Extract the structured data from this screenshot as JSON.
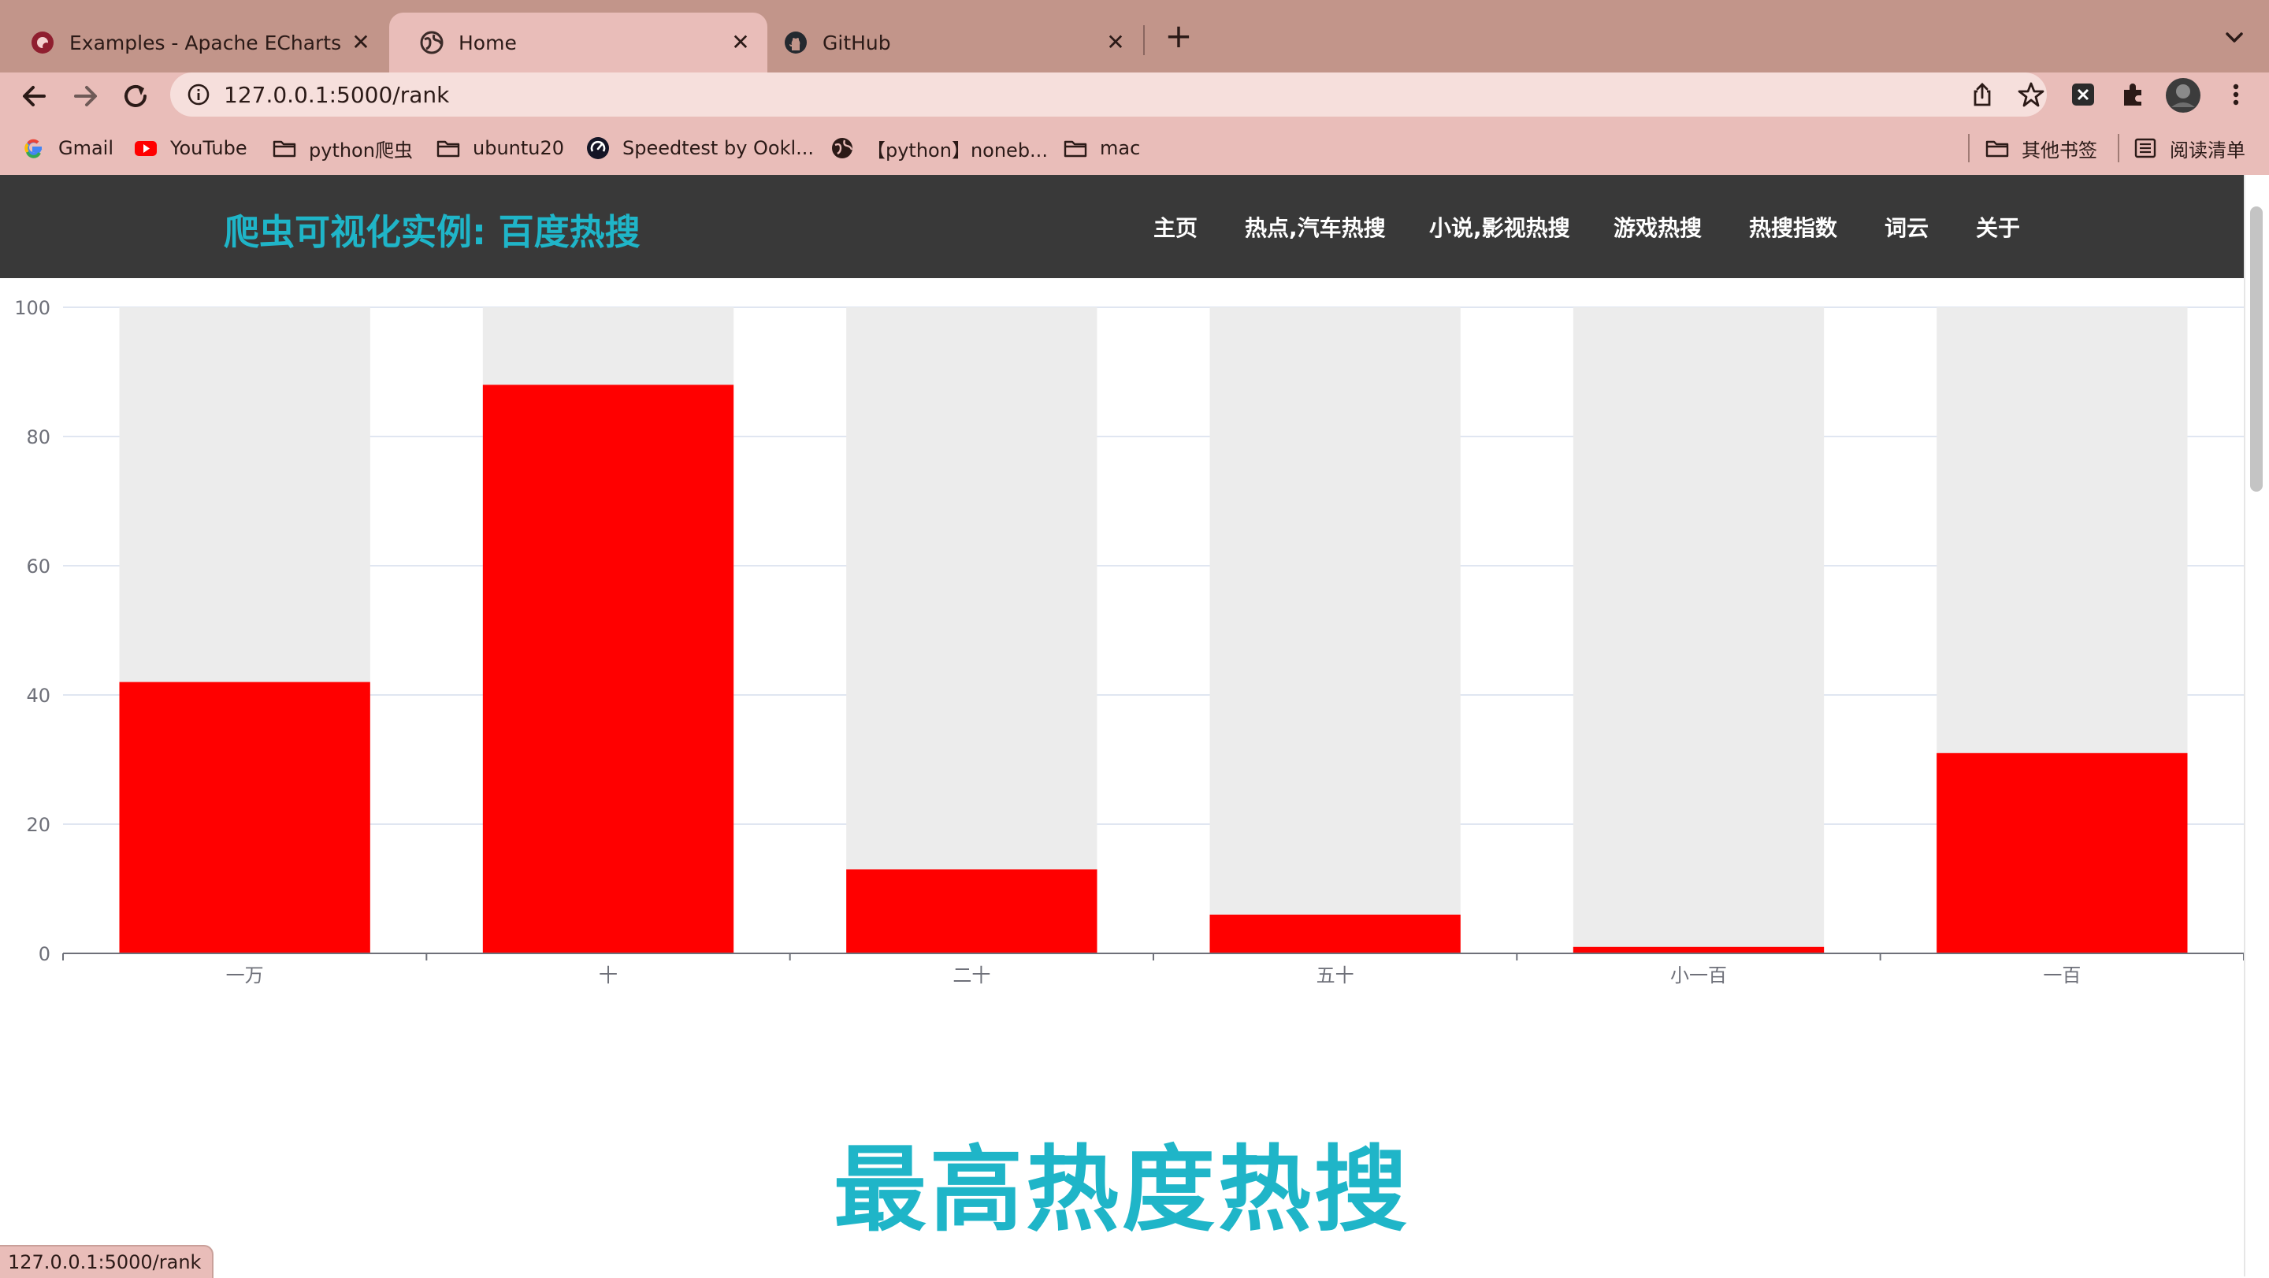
{
  "browser": {
    "tabs": [
      {
        "title": "Examples - Apache ECharts",
        "icon": "echarts-icon",
        "active": false
      },
      {
        "title": "Home",
        "icon": "globe-icon",
        "active": true
      },
      {
        "title": "GitHub",
        "icon": "github-icon",
        "active": false
      }
    ],
    "url": "127.0.0.1:5000/rank",
    "bookmarks": [
      {
        "label": "Gmail",
        "icon": "google-icon"
      },
      {
        "label": "YouTube",
        "icon": "youtube-icon"
      },
      {
        "label": "python爬虫",
        "icon": "folder-icon"
      },
      {
        "label": "ubuntu20",
        "icon": "folder-icon"
      },
      {
        "label": "Speedtest by Ookl...",
        "icon": "speedtest-icon"
      },
      {
        "label": "【python】noneb...",
        "icon": "globe-icon"
      },
      {
        "label": "mac",
        "icon": "folder-icon"
      }
    ],
    "other_bookmarks": "其他书签",
    "reading_list": "阅读清单",
    "status_url": "127.0.0.1:5000/rank"
  },
  "site": {
    "title": "爬虫可视化实例: 百度热搜",
    "nav": [
      "主页",
      "热点,汽车热搜",
      "小说,影视热搜",
      "游戏热搜",
      "热搜指数",
      "词云",
      "关于"
    ],
    "heading": "最高热度热搜"
  },
  "colors": {
    "bar": "#ff0000",
    "bar_background": "#ececec",
    "title_accent": "#1fb5c8",
    "header_bg": "#393939"
  },
  "chart_data": {
    "type": "bar",
    "categories": [
      "一万",
      "十",
      "二十",
      "五十",
      "小一百",
      "一百"
    ],
    "values": [
      42,
      88,
      13,
      6,
      1,
      31
    ],
    "ylim": [
      0,
      100
    ],
    "yticks": [
      0,
      20,
      40,
      60,
      80,
      100
    ],
    "grid": true,
    "show_background": true
  }
}
